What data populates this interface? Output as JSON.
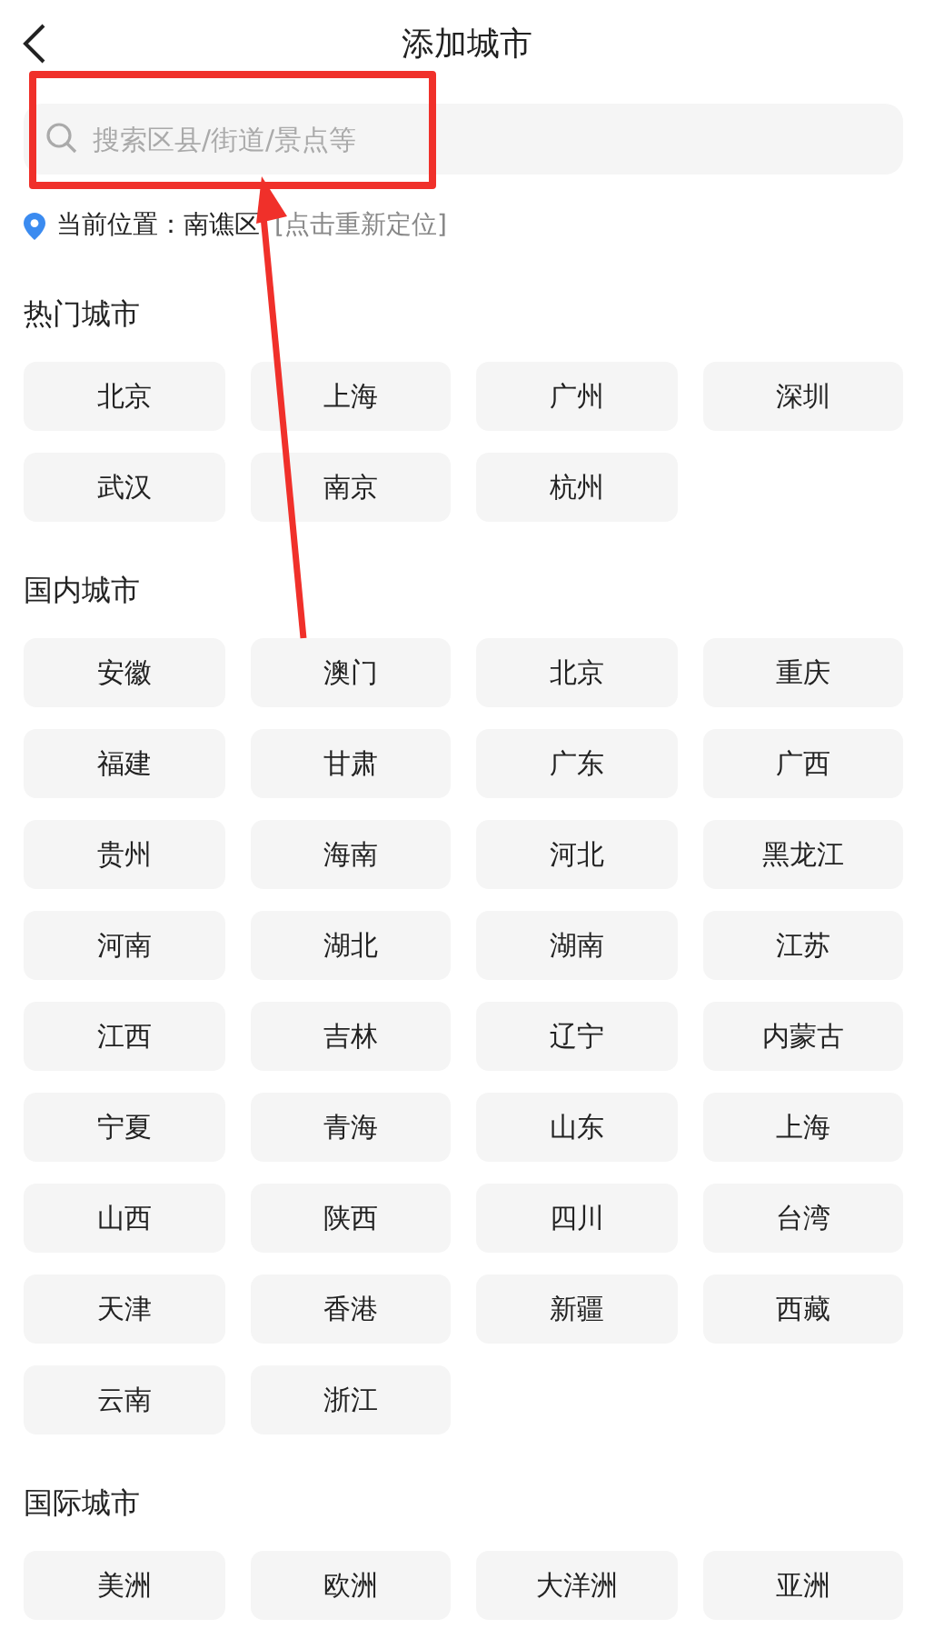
{
  "header": {
    "title": "添加城市"
  },
  "search": {
    "placeholder": "搜索区县/街道/景点等"
  },
  "location": {
    "label": "当前位置：南谯区",
    "action": "[点击重新定位]"
  },
  "sections": [
    {
      "title": "热门城市",
      "cities": [
        "北京",
        "上海",
        "广州",
        "深圳",
        "武汉",
        "南京",
        "杭州"
      ]
    },
    {
      "title": "国内城市",
      "cities": [
        "安徽",
        "澳门",
        "北京",
        "重庆",
        "福建",
        "甘肃",
        "广东",
        "广西",
        "贵州",
        "海南",
        "河北",
        "黑龙江",
        "河南",
        "湖北",
        "湖南",
        "江苏",
        "江西",
        "吉林",
        "辽宁",
        "内蒙古",
        "宁夏",
        "青海",
        "山东",
        "上海",
        "山西",
        "陕西",
        "四川",
        "台湾",
        "天津",
        "香港",
        "新疆",
        "西藏",
        "云南",
        "浙江"
      ]
    },
    {
      "title": "国际城市",
      "cities": [
        "美洲",
        "欧洲",
        "大洋洲",
        "亚洲"
      ]
    }
  ],
  "annotations": {
    "highlight_box": true,
    "arrow": true
  }
}
